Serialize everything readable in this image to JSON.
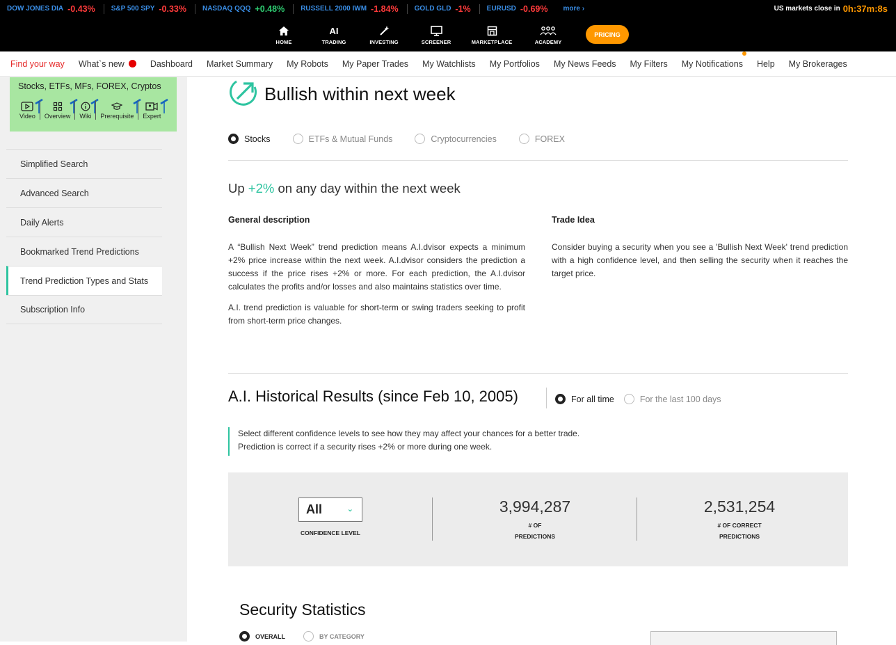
{
  "ticker": {
    "items": [
      {
        "symbol": "DOW JONES DIA",
        "change": "-0.43%",
        "dir": "neg"
      },
      {
        "symbol": "S&P 500 SPY",
        "change": "-0.33%",
        "dir": "neg"
      },
      {
        "symbol": "NASDAQ QQQ",
        "change": "+0.48%",
        "dir": "pos"
      },
      {
        "symbol": "RUSSELL 2000 IWM",
        "change": "-1.84%",
        "dir": "neg"
      },
      {
        "symbol": "GOLD GLD",
        "change": "-1%",
        "dir": "neg"
      },
      {
        "symbol": "EURUSD",
        "change": "-0.69%",
        "dir": "neg"
      }
    ],
    "more": "more ›",
    "close_label": "US markets close in",
    "close_time": "0h:37m:8s"
  },
  "mainnav": {
    "items": [
      {
        "label": "HOME",
        "icon": "home-icon"
      },
      {
        "label": "TRADING",
        "icon": "ai-icon",
        "icon_text": "AI"
      },
      {
        "label": "INVESTING",
        "icon": "magic-wand-icon"
      },
      {
        "label": "SCREENER",
        "icon": "monitor-icon"
      },
      {
        "label": "MARKETPLACE",
        "icon": "store-icon"
      },
      {
        "label": "ACADEMY",
        "icon": "people-icon"
      }
    ],
    "pricing": "PRICING"
  },
  "subnav": {
    "items": [
      "Find your way",
      "What`s new",
      "Dashboard",
      "Market Summary",
      "My Robots",
      "My Paper Trades",
      "My Watchlists",
      "My Portfolios",
      "My News Feeds",
      "My Filters",
      "My Notifications",
      "Help",
      "My Brokerages"
    ]
  },
  "sidebar": {
    "help_title": "Stocks, ETFs, MFs, FOREX, Cryptos",
    "help_items": [
      "Video",
      "Overview",
      "Wiki",
      "Prerequisite",
      "Expert"
    ],
    "items": [
      "Simplified Search",
      "Advanced Search",
      "Daily Alerts",
      "Bookmarked Trend Predictions",
      "Trend Prediction Types and Stats",
      "Subscription Info"
    ],
    "active_index": 4
  },
  "main": {
    "title": "Bullish within next week",
    "asset_types": [
      "Stocks",
      "ETFs & Mutual Funds",
      "Cryptocurrencies",
      "FOREX"
    ],
    "selected_asset": "Stocks",
    "up_prefix": "Up",
    "up_value": "+2%",
    "up_suffix": "on any day within the next week",
    "general_heading": "General description",
    "general_p1": "A “Bullish Next Week” trend prediction means A.I.dvisor expects a minimum +2% price increase within the next week. A.I.dvisor considers the prediction a success if the price rises +2% or more. For each prediction, the A.I.dvisor calculates the profits and/or losses and also maintains statistics over time.",
    "general_p2": "A.I. trend prediction is valuable for short-term or swing traders seeking to profit from short-term price changes.",
    "trade_heading": "Trade Idea",
    "trade_p1": "Consider buying a security when you see a 'Bullish Next Week' trend prediction with a high confidence level, and then selling the security when it reaches the target price.",
    "hist_title": "A.I. Historical Results (since Feb 10, 2005)",
    "hist_options": [
      "For all time",
      "For the last 100 days"
    ],
    "note_line1": "Select different confidence levels to see how they may affect your chances for a better trade.",
    "note_line2": "Prediction is correct if a security rises +2% or more during one week.",
    "confidence_value": "All",
    "confidence_label": "CONFIDENCE LEVEL",
    "predictions_value": "3,994,287",
    "predictions_label_1": "# OF",
    "predictions_label_2": "PREDICTIONS",
    "correct_value": "2,531,254",
    "correct_label_1": "# OF CORRECT",
    "correct_label_2": "PREDICTIONS",
    "security_title": "Security Statistics",
    "security_options": [
      "OVERALL",
      "BY CATEGORY"
    ]
  },
  "colors": {
    "accent": "#2ec4a0",
    "pricing": "#ff9800",
    "negative": "#ff3b3b",
    "positive": "#2ecc71",
    "helpbox": "#a8e6a1"
  }
}
